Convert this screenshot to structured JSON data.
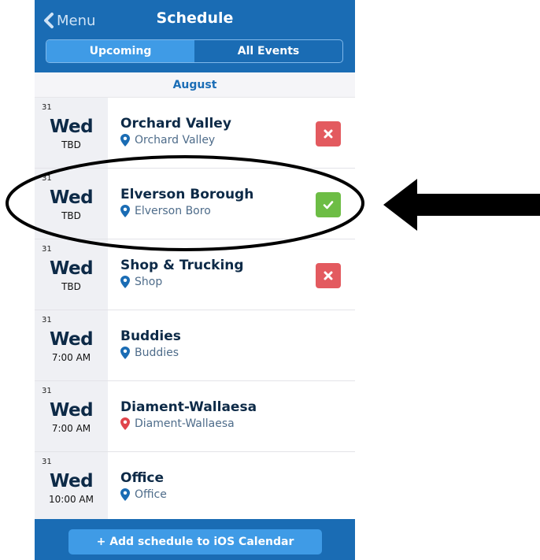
{
  "header": {
    "back_label": "Menu",
    "title": "Schedule",
    "tabs": [
      {
        "label": "Upcoming",
        "active": true
      },
      {
        "label": "All Events",
        "active": false
      }
    ]
  },
  "month_label": "August",
  "events": [
    {
      "day": "31",
      "weekday": "Wed",
      "time": "TBD",
      "title": "Orchard Valley",
      "location": "Orchard Valley",
      "pin_color": "#1a6cb4",
      "status": "declined"
    },
    {
      "day": "31",
      "weekday": "Wed",
      "time": "TBD",
      "title": "Elverson Borough",
      "location": "Elverson Boro",
      "pin_color": "#1a6cb4",
      "status": "accepted"
    },
    {
      "day": "31",
      "weekday": "Wed",
      "time": "TBD",
      "title": "Shop & Trucking",
      "location": "Shop",
      "pin_color": "#1a6cb4",
      "status": "declined"
    },
    {
      "day": "31",
      "weekday": "Wed",
      "time": "7:00 AM",
      "title": "Buddies",
      "location": "Buddies",
      "pin_color": "#1a6cb4",
      "status": "none"
    },
    {
      "day": "31",
      "weekday": "Wed",
      "time": "7:00 AM",
      "title": "Diament-Wallaesa",
      "location": "Diament-Wallaesa",
      "pin_color": "#e0444b",
      "status": "none"
    },
    {
      "day": "31",
      "weekday": "Wed",
      "time": "10:00 AM",
      "title": "Office",
      "location": "Office",
      "pin_color": "#1a6cb4",
      "status": "none"
    }
  ],
  "footer": {
    "add_button_label": "+ Add schedule to iOS Calendar"
  },
  "colors": {
    "header_bg": "#1a6cb4",
    "accent": "#3f9be6",
    "declined": "#e35a5f",
    "accepted": "#6dbd45"
  },
  "annotation": {
    "highlight": "circle-around-elverson-borough",
    "arrow": "left-pointing-arrow"
  }
}
